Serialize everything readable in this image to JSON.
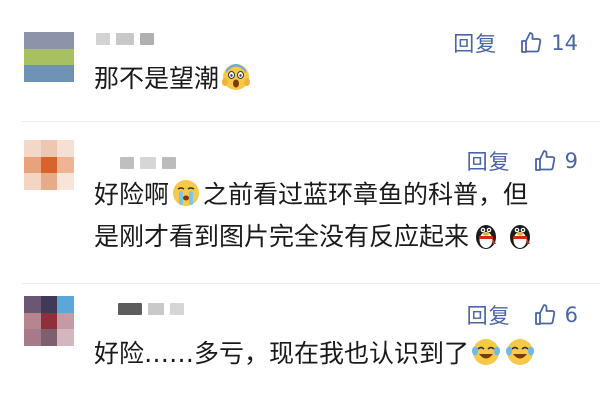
{
  "comments": [
    {
      "text": "那不是望潮",
      "reply_label": "回复",
      "likes": "14",
      "emoji_after": [
        "scream-emoji"
      ]
    },
    {
      "text_parts": [
        "好险啊",
        "之前看过蓝环章鱼的科普，但",
        "是刚才看到图片完全没有反应起来"
      ],
      "reply_label": "回复",
      "likes": "9",
      "emoji_inline": "crying-emoji",
      "emoji_end": [
        "qq-penguin-emoji",
        "qq-penguin-emoji"
      ]
    },
    {
      "text": "好险……多亏，现在我也认识到了",
      "reply_label": "回复",
      "likes": "6",
      "emoji_end": [
        "laugh-cry-emoji",
        "laugh-cry-emoji"
      ]
    }
  ],
  "colors": {
    "action": "#4a66a8",
    "text": "#1a1a1a",
    "divider": "#ececec"
  }
}
